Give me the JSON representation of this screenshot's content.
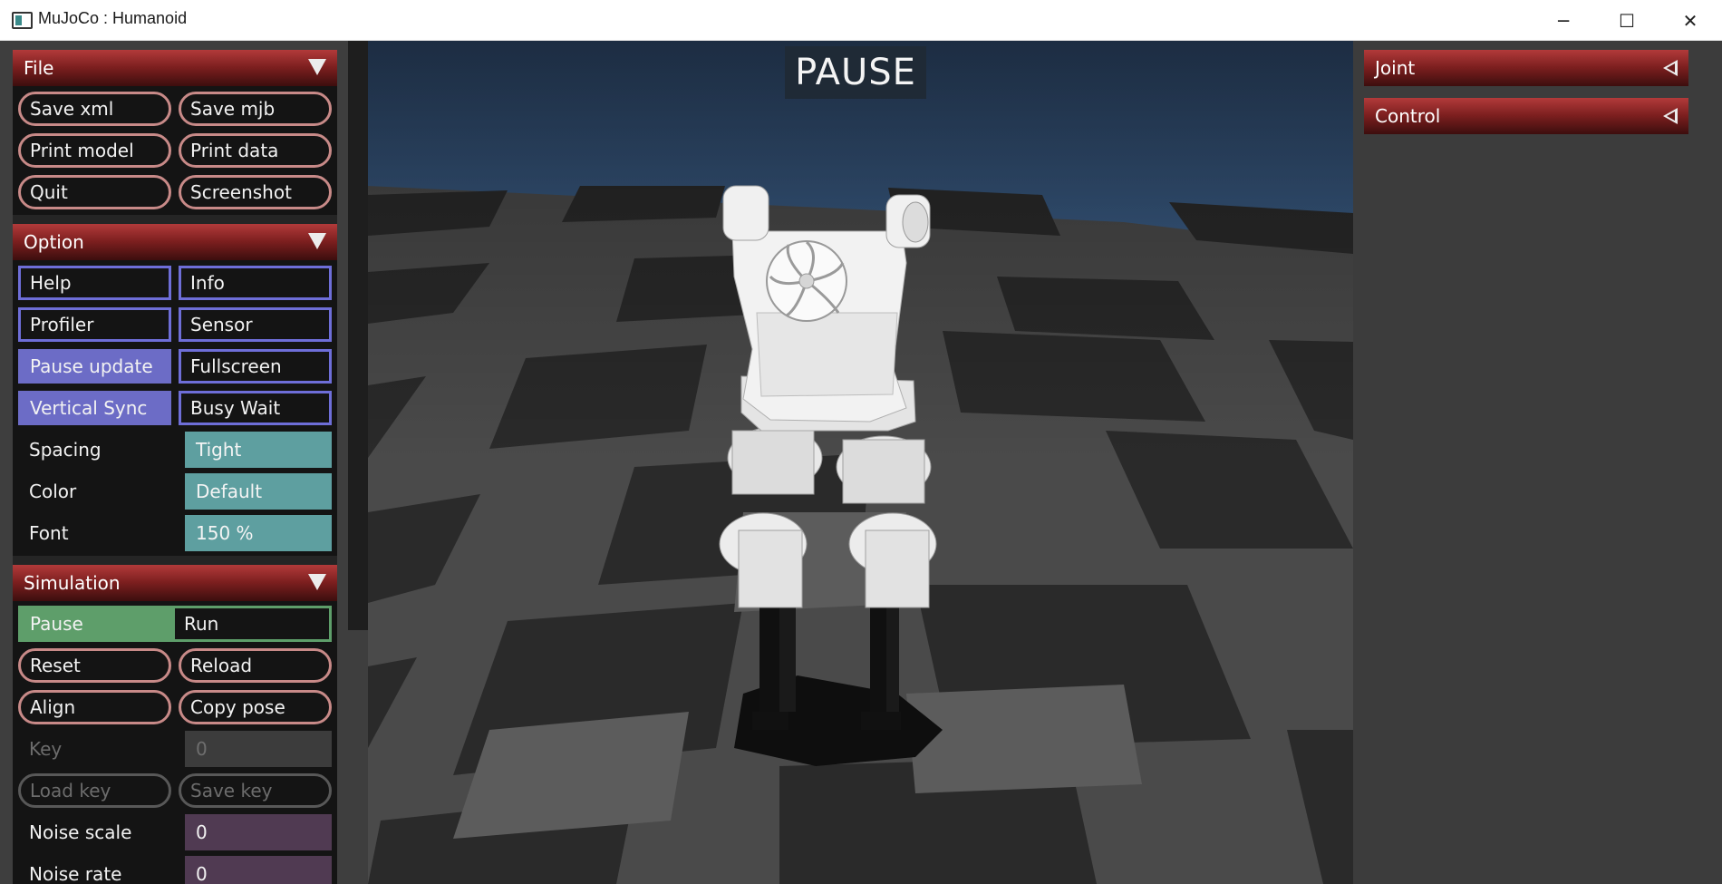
{
  "window": {
    "title": "MuJoCo : Humanoid",
    "minimize_glyph": "─",
    "maximize_glyph": "☐",
    "close_glyph": "✕"
  },
  "overlay": {
    "status": "PAUSE"
  },
  "file": {
    "title": "File",
    "buttons": [
      "Save xml",
      "Save mjb",
      "Print model",
      "Print data",
      "Quit",
      "Screenshot"
    ]
  },
  "option": {
    "title": "Option",
    "checkboxes": [
      {
        "label": "Help",
        "checked": false
      },
      {
        "label": "Info",
        "checked": false
      },
      {
        "label": "Profiler",
        "checked": false
      },
      {
        "label": "Sensor",
        "checked": false
      },
      {
        "label": "Pause update",
        "checked": true
      },
      {
        "label": "Fullscreen",
        "checked": false
      },
      {
        "label": "Vertical Sync",
        "checked": true
      },
      {
        "label": "Busy Wait",
        "checked": false
      }
    ],
    "spacing_label": "Spacing",
    "spacing_value": "Tight",
    "color_label": "Color",
    "color_value": "Default",
    "font_label": "Font",
    "font_value": "150 %"
  },
  "simulation": {
    "title": "Simulation",
    "radio": [
      "Pause",
      "Run"
    ],
    "selected": "Pause",
    "reset": "Reset",
    "reload": "Reload",
    "align": "Align",
    "copy_pose": "Copy pose",
    "key_label": "Key",
    "key_value": "0",
    "load_key": "Load key",
    "save_key": "Save key",
    "noise_scale_label": "Noise scale",
    "noise_scale_value": "0",
    "noise_rate_label": "Noise rate",
    "noise_rate_value": "0"
  },
  "right_panel": {
    "joint": "Joint",
    "control": "Control"
  },
  "colors": {
    "section_header": "#8a2424",
    "button_border": "#c88a88",
    "checkbox_border": "#6e6ed8",
    "select_bg": "#5e9fa0",
    "radio_green": "#5e9e6a",
    "sky": "#3a5a80"
  }
}
